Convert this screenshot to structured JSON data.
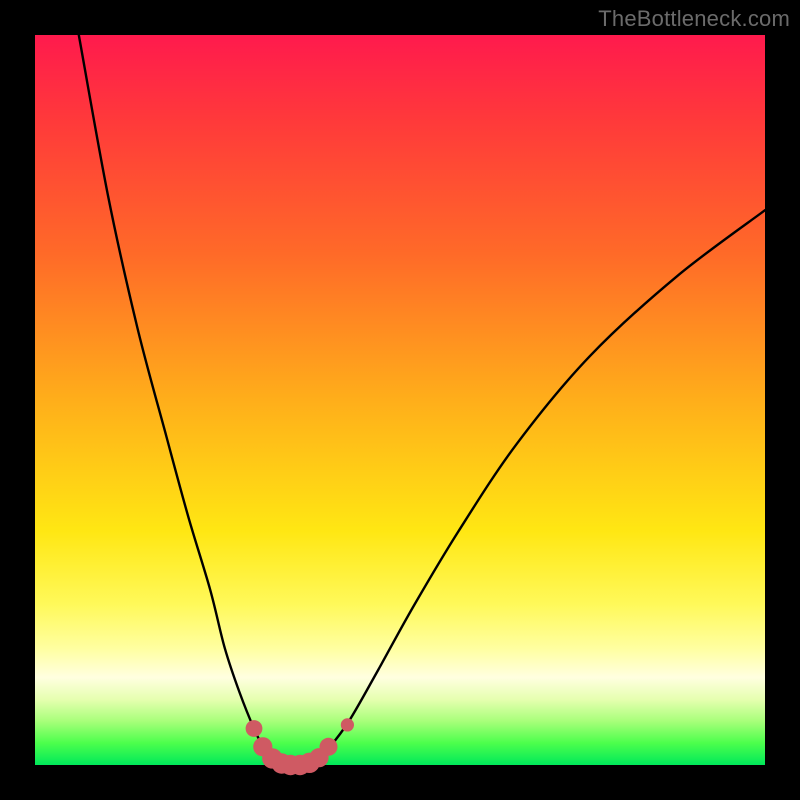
{
  "watermark": "TheBottleneck.com",
  "chart_data": {
    "type": "line",
    "title": "",
    "xlabel": "",
    "ylabel": "",
    "xlim": [
      0,
      100
    ],
    "ylim": [
      0,
      100
    ],
    "series": [
      {
        "name": "curve",
        "x": [
          6,
          10,
          14,
          18,
          21,
          24,
          26,
          28,
          30,
          31.5,
          33,
          35,
          37,
          38.5,
          40,
          43,
          47,
          52,
          58,
          66,
          76,
          88,
          100
        ],
        "y": [
          100,
          78,
          60,
          45,
          34,
          24,
          16,
          10,
          5,
          2,
          0.5,
          0,
          0,
          0.5,
          2,
          6,
          13,
          22,
          32,
          44,
          56,
          67,
          76
        ]
      }
    ],
    "markers": {
      "name": "highlight-dots",
      "color": "#cf5a63",
      "points": [
        {
          "x": 30.0,
          "y": 5.0,
          "r": 2.8
        },
        {
          "x": 31.2,
          "y": 2.5,
          "r": 3.2
        },
        {
          "x": 32.5,
          "y": 0.9,
          "r": 3.4
        },
        {
          "x": 33.8,
          "y": 0.2,
          "r": 3.4
        },
        {
          "x": 35.0,
          "y": 0.0,
          "r": 3.4
        },
        {
          "x": 36.3,
          "y": 0.0,
          "r": 3.4
        },
        {
          "x": 37.6,
          "y": 0.3,
          "r": 3.4
        },
        {
          "x": 38.9,
          "y": 1.0,
          "r": 3.2
        },
        {
          "x": 40.2,
          "y": 2.5,
          "r": 3.0
        },
        {
          "x": 42.8,
          "y": 5.5,
          "r": 2.2
        }
      ]
    },
    "background_gradient": {
      "stops": [
        {
          "pos": 0.0,
          "color": "#ff1a4d"
        },
        {
          "pos": 0.5,
          "color": "#ffae1a"
        },
        {
          "pos": 0.78,
          "color": "#fff95a"
        },
        {
          "pos": 0.94,
          "color": "#a8ff7a"
        },
        {
          "pos": 1.0,
          "color": "#00e85a"
        }
      ]
    }
  }
}
